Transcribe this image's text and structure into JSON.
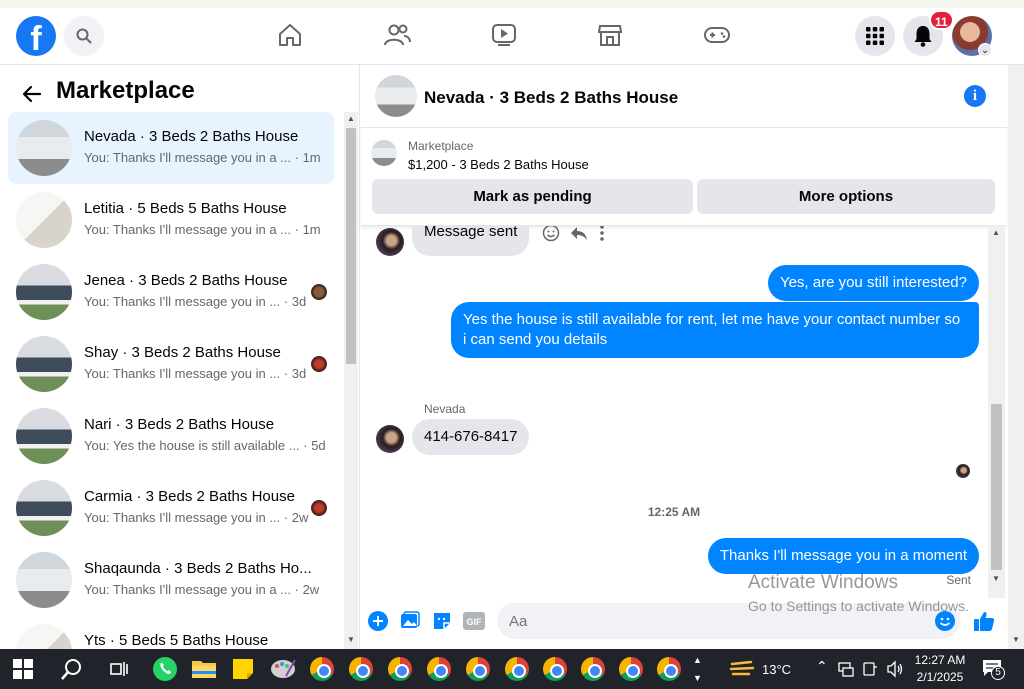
{
  "topbar": {
    "logo": "f",
    "notifications_count": "11"
  },
  "sidebar": {
    "title": "Marketplace",
    "conversations": [
      {
        "title": "Nevada · 3 Beds 2 Baths House",
        "preview": "You: Thanks I'll message you in a ...",
        "time": "· 1m",
        "active": true
      },
      {
        "title": "Letitia · 5 Beds 5 Baths House",
        "preview": "You: Thanks I'll message you in a ...",
        "time": "· 1m"
      },
      {
        "title": "Jenea · 3 Beds 2 Baths House",
        "preview": "You: Thanks I'll message you in ...",
        "time": "· 3d"
      },
      {
        "title": "Shay · 3 Beds 2 Baths House",
        "preview": "You: Thanks I'll message you in ...",
        "time": "· 3d"
      },
      {
        "title": "Nari · 3 Beds 2 Baths House",
        "preview": "You: Yes the house is still available ...",
        "time": "· 5d"
      },
      {
        "title": "Carmia · 3 Beds 2 Baths House",
        "preview": "You: Thanks I'll message you in ...",
        "time": "· 2w"
      },
      {
        "title": "Shaqaunda · 3 Beds 2 Baths Ho...",
        "preview": "You: Thanks I'll message you in a ...",
        "time": "· 2w"
      },
      {
        "title": "Yts · 5 Beds 5 Baths House",
        "preview": "",
        "time": ""
      }
    ]
  },
  "chat": {
    "title": "Nevada · 3 Beds 2 Baths House",
    "listing_source": "Marketplace",
    "listing_price": "$1,200 - 3 Beds 2 Baths House",
    "mark_pending_label": "Mark as pending",
    "more_options_label": "More options",
    "messages": {
      "m1": "Message sent",
      "m2": "Yes, are you still interested?",
      "m3": "Yes the house is still available for rent, let me have your contact number so i can send you details",
      "sender_name": "Nevada",
      "m4": "414-676-8417",
      "timestamp": "12:25 AM",
      "m5": "Thanks I'll message you in a moment",
      "status": "Sent"
    },
    "composer_placeholder": "Aa"
  },
  "watermark": {
    "line1": "Activate Windows",
    "line2": "Go to Settings to activate Windows."
  },
  "taskbar": {
    "temperature": "13°C",
    "time": "12:27 AM",
    "date": "2/1/2025",
    "notif_count": "5"
  }
}
